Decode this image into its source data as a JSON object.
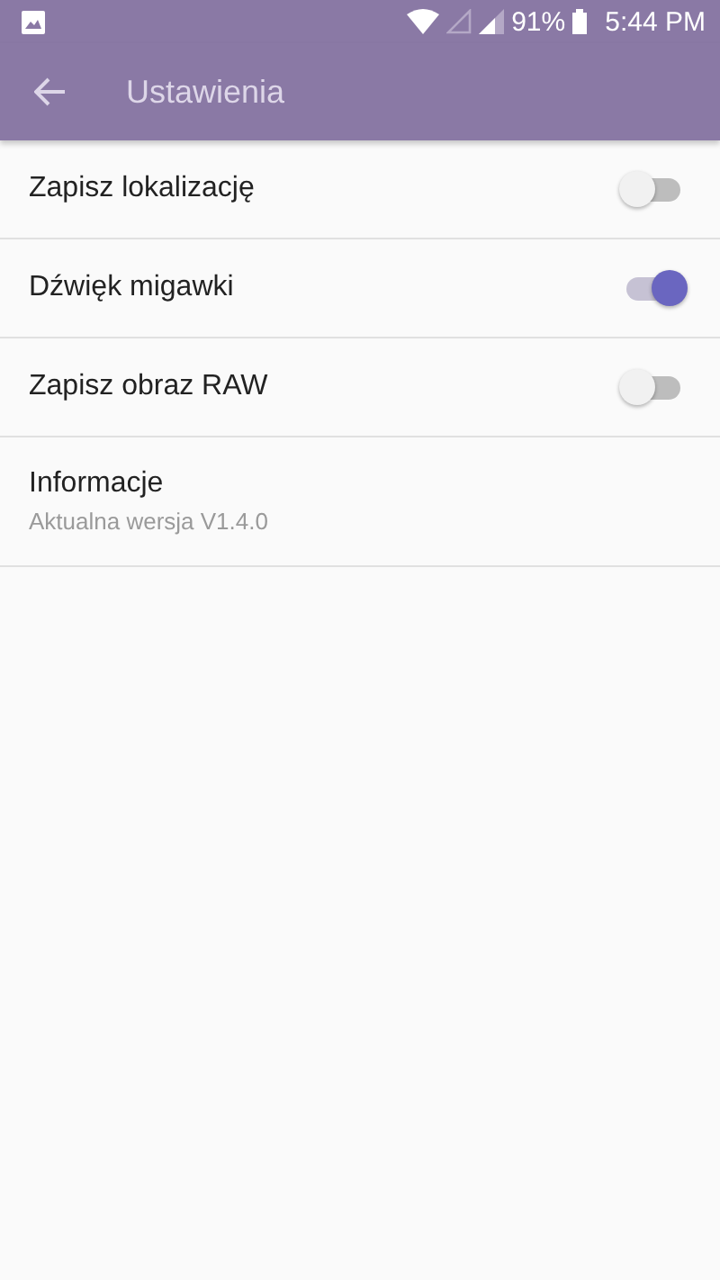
{
  "status_bar": {
    "battery": "91%",
    "time": "5:44 PM"
  },
  "app_bar": {
    "title": "Ustawienia"
  },
  "settings": [
    {
      "kind": "switch",
      "label": "Zapisz lokalizację",
      "on": false
    },
    {
      "kind": "switch",
      "label": "Dźwięk migawki",
      "on": true
    },
    {
      "kind": "switch",
      "label": "Zapisz obraz RAW",
      "on": false
    },
    {
      "kind": "info",
      "label": "Informacje",
      "summary": "Aktualna wersja V1.4.0"
    }
  ]
}
